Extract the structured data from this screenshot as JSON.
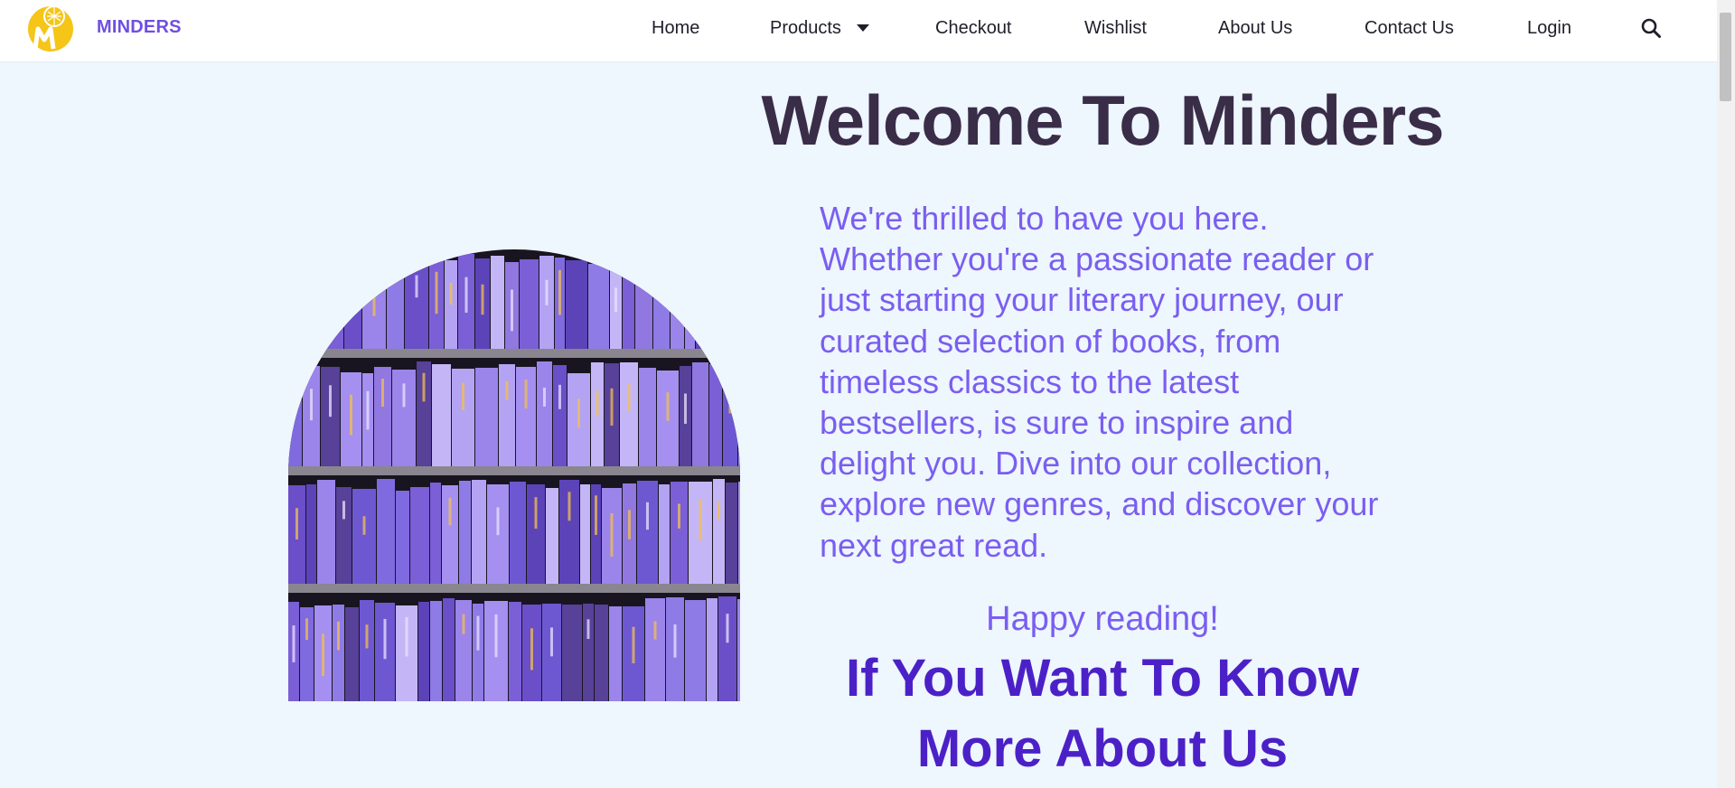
{
  "brand": {
    "name": "MINDERS",
    "logo_icon": "lightbulb-m-logo-icon",
    "logo_color": "#f5c518"
  },
  "nav": {
    "items": [
      {
        "label": "Home"
      },
      {
        "label": "Products"
      },
      {
        "label": "Checkout"
      },
      {
        "label": "Wishlist"
      },
      {
        "label": "About Us"
      },
      {
        "label": "Contact Us"
      },
      {
        "label": "Login"
      }
    ],
    "search_icon": "search-icon",
    "dropdown_icon": "caret-down-icon"
  },
  "hero": {
    "title": "Welcome To Minders",
    "intro": "We're thrilled to have you here. Whether you're a passionate reader or just starting your literary journey, our curated selection of books, from timeless classics to the latest bestsellers, is sure to inspire and delight you. Dive into our collection, explore new genres, and discover your next great read.",
    "happy": "Happy reading!",
    "cta_line1": "If You Want To Know",
    "cta_line2": "More About Us",
    "image": "purple-bookshelf-arch-image"
  },
  "colors": {
    "accent": "#7a5ef0",
    "cta": "#4b21c7",
    "title": "#3a2d48",
    "background": "#eef6fe"
  }
}
